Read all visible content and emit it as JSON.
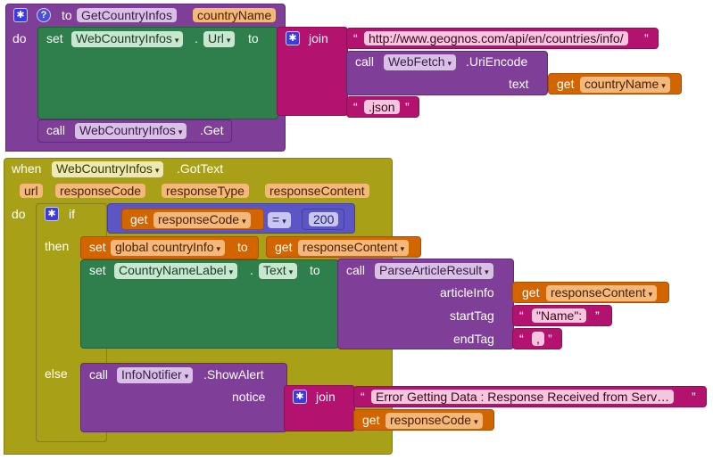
{
  "proc": {
    "to": "to",
    "name": "GetCountryInfos",
    "param": "countryName",
    "do": "do",
    "set": "set",
    "component": "WebCountryInfos",
    "dot": ".",
    "prop": "Url",
    "to_kw": "to",
    "join": "join",
    "url_string": "http://www.geognos.com/api/en/countries/info/",
    "call": "call",
    "webfetch": "WebFetch",
    "uriencode": ".UriEncode",
    "text_label": "text",
    "get": "get",
    "get_var": "countryName",
    "json_string": ".json",
    "call2": "call",
    "component2": "WebCountryInfos",
    "method2": ".Get"
  },
  "event": {
    "when": "when",
    "component": "WebCountryInfos",
    "event": ".GotText",
    "params": [
      "url",
      "responseCode",
      "responseType",
      "responseContent"
    ],
    "do": "do",
    "if": "if",
    "then": "then",
    "else": "else",
    "get": "get",
    "cond_var": "responseCode",
    "op": "=",
    "num": "200",
    "set": "set",
    "global_var": "global countryInfo",
    "to_kw": "to",
    "get2": "get",
    "content_var": "responseContent",
    "set2": "set",
    "label_comp": "CountryNameLabel",
    "dot": ".",
    "label_prop": "Text",
    "to_kw2": "to",
    "call": "call",
    "parse_fn": "ParseArticleResult",
    "article_label": "articleInfo",
    "get3": "get",
    "article_var": "responseContent",
    "start_label": "startTag",
    "start_str": "\"Name\":",
    "end_label": "endTag",
    "end_str": ",",
    "call2": "call",
    "notifier": "InfoNotifier",
    "showalert": ".ShowAlert",
    "notice_label": "notice",
    "join": "join",
    "err_str": "Error Getting Data : Response Received from Serv…",
    "get4": "get",
    "err_var": "responseCode"
  },
  "glyphs": {
    "gear": "✱",
    "help": "?",
    "caret": "▾",
    "lquote": "“",
    "rquote": "”"
  },
  "colors": {
    "procedure": "#7f3e98",
    "setter": "#2e7f4c",
    "event": "#a8a118",
    "variable": "#d26500",
    "text": "#b3136e",
    "logic": "#5b55c6"
  }
}
